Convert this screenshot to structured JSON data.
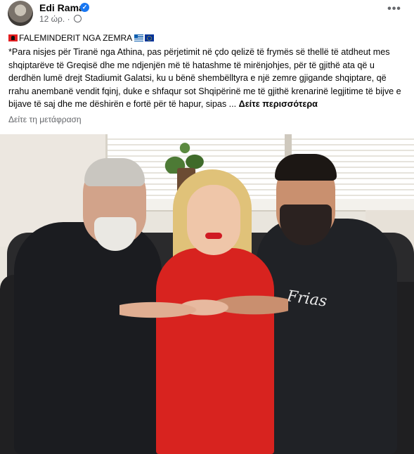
{
  "header": {
    "author": "Edi Rama",
    "verified_mark": "✓",
    "timestamp": "12 ώρ.",
    "separator": "·",
    "privacy_icon": "globe-icon",
    "more_label": "•••"
  },
  "post": {
    "headline": "FALEMINDERIT NGA ZEMRA",
    "headline_flags": [
      "albania-flag",
      "greece-flag",
      "eu-flag"
    ],
    "body": "*Para nisjes për Tiranë nga Athina, pas përjetimit në çdo qelizë të frymës së thellë të atdheut mes shqiptarëve të Greqisë dhe me ndjenjën më të hatashme të mirënjohjes, për të gjithë ata që u derdhën lumë drejt Stadiumit Galatsi, ku u bënë shembëlltyra e një zemre gjigande shqiptare, që rrahu anembanë vendit fqinj, duke e shfaqur sot Shqipërinë me të gjithë krenarinë legjitime të bijve e bijave të saj dhe me dëshirën e fortë për të hapur, sipas ...",
    "see_more": "Δείτε περισσότερα",
    "translate": "Δείτε τη μετάφραση"
  },
  "photo": {
    "shirt_text": "Frias"
  },
  "colors": {
    "link_gray": "#65676b",
    "verified_blue": "#1877f2",
    "dress_red": "#d8231f"
  }
}
